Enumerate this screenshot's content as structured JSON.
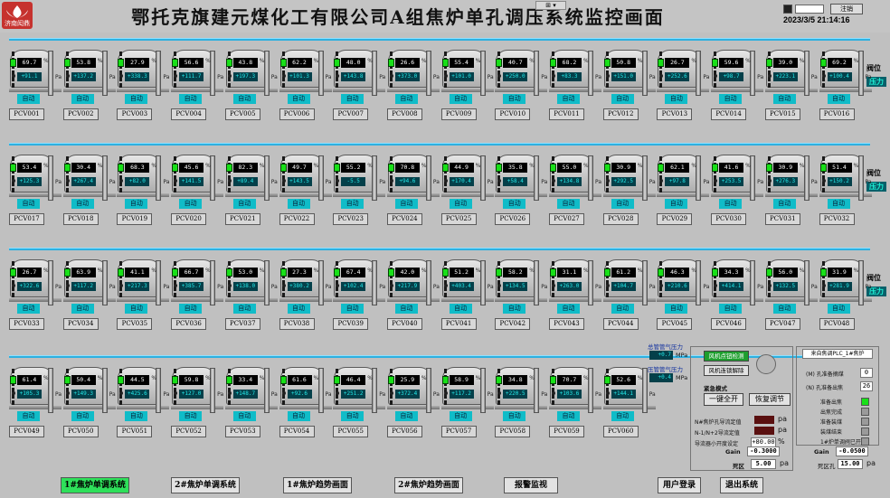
{
  "header": {
    "title": "鄂托克旗建元煤化工有限公司A组焦炉单孔调压系统监控画面",
    "logo_text": "济南闳鼎",
    "view_dropdown": "⊞ ▾",
    "logout_label": "注销",
    "datetime": "2023/3/5 21:14:16"
  },
  "rows": [
    {
      "side_labels": [
        "阀位",
        "压力"
      ],
      "units": [
        {
          "pct": "69.7",
          "pa": "+91.1",
          "mode": "自动",
          "name": "PCV001"
        },
        {
          "pct": "53.8",
          "pa": "+137.2",
          "mode": "自动",
          "name": "PCV002"
        },
        {
          "pct": "27.9",
          "pa": "+338.3",
          "mode": "自动",
          "name": "PCV003"
        },
        {
          "pct": "56.6",
          "pa": "+111.7",
          "mode": "自动",
          "name": "PCV004"
        },
        {
          "pct": "43.8",
          "pa": "+197.3",
          "mode": "自动",
          "name": "PCV005"
        },
        {
          "pct": "62.2",
          "pa": "+101.3",
          "mode": "自动",
          "name": "PCV006"
        },
        {
          "pct": "48.0",
          "pa": "+143.8",
          "mode": "自动",
          "name": "PCV007"
        },
        {
          "pct": "26.6",
          "pa": "+373.0",
          "mode": "自动",
          "name": "PCV008"
        },
        {
          "pct": "55.4",
          "pa": "+101.0",
          "mode": "自动",
          "name": "PCV009"
        },
        {
          "pct": "40.7",
          "pa": "+250.0",
          "mode": "自动",
          "name": "PCV010"
        },
        {
          "pct": "68.2",
          "pa": "+83.3",
          "mode": "自动",
          "name": "PCV011"
        },
        {
          "pct": "50.8",
          "pa": "+151.0",
          "mode": "自动",
          "name": "PCV012"
        },
        {
          "pct": "26.7",
          "pa": "+252.6",
          "mode": "自动",
          "name": "PCV013"
        },
        {
          "pct": "59.6",
          "pa": "+98.7",
          "mode": "自动",
          "name": "PCV014"
        },
        {
          "pct": "39.0",
          "pa": "+223.1",
          "mode": "自动",
          "name": "PCV015"
        },
        {
          "pct": "69.2",
          "pa": "+100.4",
          "mode": "自动",
          "name": "PCV016"
        }
      ]
    },
    {
      "side_labels": [
        "阀位",
        "压力"
      ],
      "units": [
        {
          "pct": "53.4",
          "pa": "+125.3",
          "mode": "自动",
          "name": "PCV017"
        },
        {
          "pct": "30.4",
          "pa": "+267.4",
          "mode": "自动",
          "name": "PCV018"
        },
        {
          "pct": "68.3",
          "pa": "+82.0",
          "mode": "自动",
          "name": "PCV019"
        },
        {
          "pct": "45.6",
          "pa": "+141.5",
          "mode": "自动",
          "name": "PCV020"
        },
        {
          "pct": "82.3",
          "pa": "+89.4",
          "mode": "自动",
          "name": "PCV021"
        },
        {
          "pct": "49.7",
          "pa": "+143.5",
          "mode": "自动",
          "name": "PCV022"
        },
        {
          "pct": "55.2",
          "pa": "-5.5",
          "mode": "自动",
          "name": "PCV023"
        },
        {
          "pct": "70.8",
          "pa": "+94.6",
          "mode": "自动",
          "name": "PCV024"
        },
        {
          "pct": "44.9",
          "pa": "+170.4",
          "mode": "自动",
          "name": "PCV025"
        },
        {
          "pct": "35.8",
          "pa": "+58.4",
          "mode": "自动",
          "name": "PCV026"
        },
        {
          "pct": "55.0",
          "pa": "+134.8",
          "mode": "自动",
          "name": "PCV027"
        },
        {
          "pct": "30.9",
          "pa": "+292.5",
          "mode": "自动",
          "name": "PCV028"
        },
        {
          "pct": "62.1",
          "pa": "+97.8",
          "mode": "自动",
          "name": "PCV029"
        },
        {
          "pct": "41.6",
          "pa": "+253.5",
          "mode": "自动",
          "name": "PCV030"
        },
        {
          "pct": "30.9",
          "pa": "+276.3",
          "mode": "自动",
          "name": "PCV031"
        },
        {
          "pct": "51.4",
          "pa": "+150.2",
          "mode": "自动",
          "name": "PCV032"
        }
      ]
    },
    {
      "side_labels": [
        "阀位",
        "压力"
      ],
      "units": [
        {
          "pct": "26.7",
          "pa": "+322.6",
          "mode": "自动",
          "name": "PCV033"
        },
        {
          "pct": "63.9",
          "pa": "+117.2",
          "mode": "自动",
          "name": "PCV034"
        },
        {
          "pct": "41.1",
          "pa": "+217.3",
          "mode": "自动",
          "name": "PCV035"
        },
        {
          "pct": "66.7",
          "pa": "+385.7",
          "mode": "自动",
          "name": "PCV036"
        },
        {
          "pct": "53.0",
          "pa": "+138.0",
          "mode": "自动",
          "name": "PCV037"
        },
        {
          "pct": "27.3",
          "pa": "+380.2",
          "mode": "自动",
          "name": "PCV038"
        },
        {
          "pct": "67.4",
          "pa": "+102.4",
          "mode": "自动",
          "name": "PCV039"
        },
        {
          "pct": "42.0",
          "pa": "+217.9",
          "mode": "自动",
          "name": "PCV040"
        },
        {
          "pct": "51.2",
          "pa": "+403.4",
          "mode": "自动",
          "name": "PCV041"
        },
        {
          "pct": "58.2",
          "pa": "+134.5",
          "mode": "自动",
          "name": "PCV042"
        },
        {
          "pct": "31.1",
          "pa": "+263.0",
          "mode": "自动",
          "name": "PCV043"
        },
        {
          "pct": "61.2",
          "pa": "+104.7",
          "mode": "自动",
          "name": "PCV044"
        },
        {
          "pct": "46.3",
          "pa": "+210.6",
          "mode": "自动",
          "name": "PCV045"
        },
        {
          "pct": "34.3",
          "pa": "+414.1",
          "mode": "自动",
          "name": "PCV046"
        },
        {
          "pct": "56.0",
          "pa": "+132.5",
          "mode": "自动",
          "name": "PCV047"
        },
        {
          "pct": "31.9",
          "pa": "+281.9",
          "mode": "自动",
          "name": "PCV048"
        }
      ]
    },
    {
      "side_labels": [],
      "units": [
        {
          "pct": "61.4",
          "pa": "+105.3",
          "mode": "自动",
          "name": "PCV049"
        },
        {
          "pct": "50.4",
          "pa": "+149.3",
          "mode": "自动",
          "name": "PCV050"
        },
        {
          "pct": "44.5",
          "pa": "+425.6",
          "mode": "自动",
          "name": "PCV051"
        },
        {
          "pct": "59.8",
          "pa": "+127.0",
          "mode": "自动",
          "name": "PCV052"
        },
        {
          "pct": "33.4",
          "pa": "+148.7",
          "mode": "自动",
          "name": "PCV053"
        },
        {
          "pct": "61.6",
          "pa": "+92.6",
          "mode": "自动",
          "name": "PCV054"
        },
        {
          "pct": "46.4",
          "pa": "+251.2",
          "mode": "自动",
          "name": "PCV055"
        },
        {
          "pct": "25.9",
          "pa": "+372.4",
          "mode": "自动",
          "name": "PCV056"
        },
        {
          "pct": "58.9",
          "pa": "+117.2",
          "mode": "自动",
          "name": "PCV057"
        },
        {
          "pct": "34.8",
          "pa": "+220.5",
          "mode": "自动",
          "name": "PCV058"
        },
        {
          "pct": "70.7",
          "pa": "+103.6",
          "mode": "自动",
          "name": "PCV059"
        },
        {
          "pct": "52.6",
          "pa": "+144.1",
          "mode": "自动",
          "name": "PCV060"
        }
      ]
    }
  ],
  "units_text": {
    "pct": "%",
    "pa": "Pa"
  },
  "air": {
    "main_pressure_label": "总管管气压力",
    "main_pressure_value": "+0.7",
    "secondary_pressure_label": "压管管气压力",
    "secondary_pressure_value": "+0.4",
    "unit": "MPa"
  },
  "emergency": {
    "fan_check": "风机点钮检测",
    "fan_release": "风机连锁解除",
    "mode_label": "紧急模式",
    "open_all": "一键全开",
    "restore": "恢复调节",
    "rows": [
      {
        "label": "N#焦炉孔导流定值",
        "value": "",
        "unit": "pa"
      },
      {
        "label": "N-1/N+2导流定值",
        "value": "",
        "unit": "pa"
      },
      {
        "label": "导流器小开度设定",
        "value": "+80.00",
        "unit": "%"
      }
    ],
    "gain_label": "Gain",
    "gain_value": "-0.3000",
    "deadband_label": "死区",
    "deadband_value": "5.00",
    "deadband_unit": "pa"
  },
  "plc": {
    "title": "来自焦调PLC_1#焦炉",
    "m_label": "(M) 孔准备摘煤",
    "m_value": "0",
    "n_label": "(N) 孔准备出焦",
    "n_value": "26",
    "status": [
      {
        "label": "准备出焦",
        "state": "on"
      },
      {
        "label": "出焦完成",
        "state": "off"
      },
      {
        "label": "准备装煤",
        "state": "off"
      },
      {
        "label": "装煤结束",
        "state": "off"
      },
      {
        "label": "1#炉单调阀已开",
        "state": "off"
      }
    ]
  },
  "right_gain": {
    "gain_label": "Gain",
    "gain_value": "-0.0500",
    "deadband_label": "死区孔",
    "deadband_value": "15.00",
    "deadband_unit": "pa"
  },
  "nav": [
    "1#焦炉单调系统",
    "2#焦炉单调系统",
    "1#焦炉趋势画面",
    "2#焦炉趋势画面",
    "报警监视",
    "用户登录",
    "退出系统"
  ],
  "colors": {
    "pipe": "#2eb0e0",
    "led_green": "#18e018",
    "auto_btn": "#10bcc8",
    "active_nav": "#2ee05a"
  }
}
